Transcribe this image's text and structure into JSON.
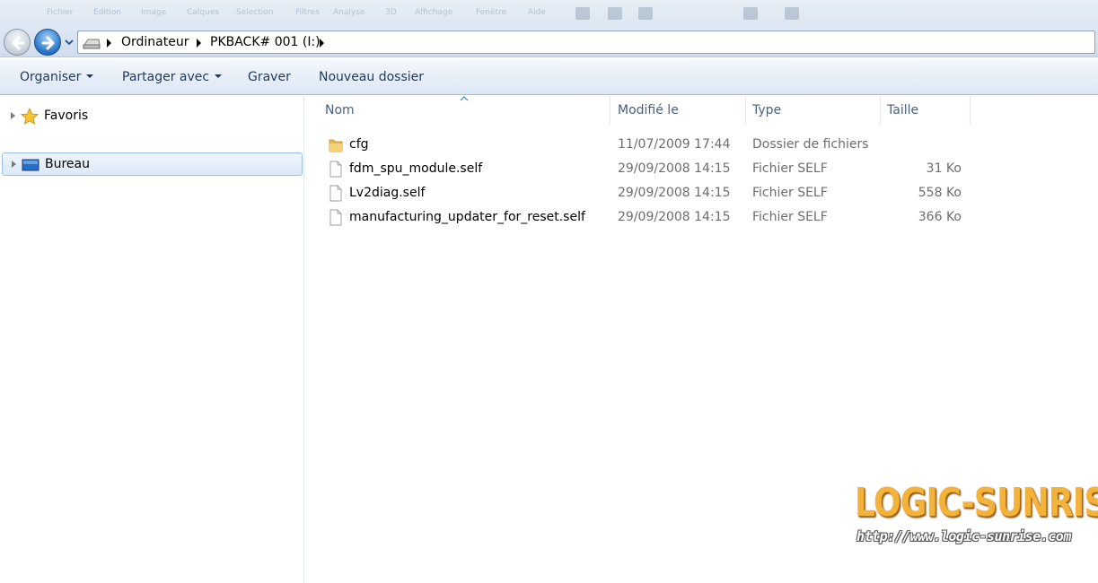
{
  "background_menu": {
    "items": [
      "Fichier",
      "Edition",
      "Image",
      "Calques",
      "Sélection",
      "Filtres",
      "Analyse",
      "3D",
      "Affichage",
      "Fenêtre",
      "Aide"
    ]
  },
  "navigation": {
    "breadcrumb": [
      "Ordinateur",
      "PKBACK# 001 (I:)"
    ]
  },
  "toolbar": {
    "organize_label": "Organiser",
    "share_label": "Partager avec",
    "burn_label": "Graver",
    "new_folder_label": "Nouveau dossier"
  },
  "navpane": {
    "items": [
      {
        "label": "Favoris",
        "icon": "star-icon"
      },
      {
        "label": "Bureau",
        "icon": "desktop-icon",
        "selected": true
      }
    ]
  },
  "filelist": {
    "columns": {
      "name": "Nom",
      "modified": "Modifié le",
      "type": "Type",
      "size": "Taille"
    },
    "rows": [
      {
        "name": "cfg",
        "modified": "11/07/2009 17:44",
        "type": "Dossier de fichiers",
        "size": "",
        "icon": "folder-icon"
      },
      {
        "name": "fdm_spu_module.self",
        "modified": "29/09/2008 14:15",
        "type": "Fichier SELF",
        "size": "31 Ko",
        "icon": "file-icon"
      },
      {
        "name": "Lv2diag.self",
        "modified": "29/09/2008 14:15",
        "type": "Fichier SELF",
        "size": "558 Ko",
        "icon": "file-icon"
      },
      {
        "name": "manufacturing_updater_for_reset.self",
        "modified": "29/09/2008 14:15",
        "type": "Fichier SELF",
        "size": "366 Ko",
        "icon": "file-icon"
      }
    ]
  },
  "watermark": {
    "brand": "LOGIC-SUNRISE",
    "url": "http://www.logic-sunrise.com"
  },
  "colors": {
    "accent": "#2c78c8",
    "toolbar_text": "#1e395b",
    "selection_border": "#9ebfe5",
    "watermark_gold": "#f3b33a"
  }
}
